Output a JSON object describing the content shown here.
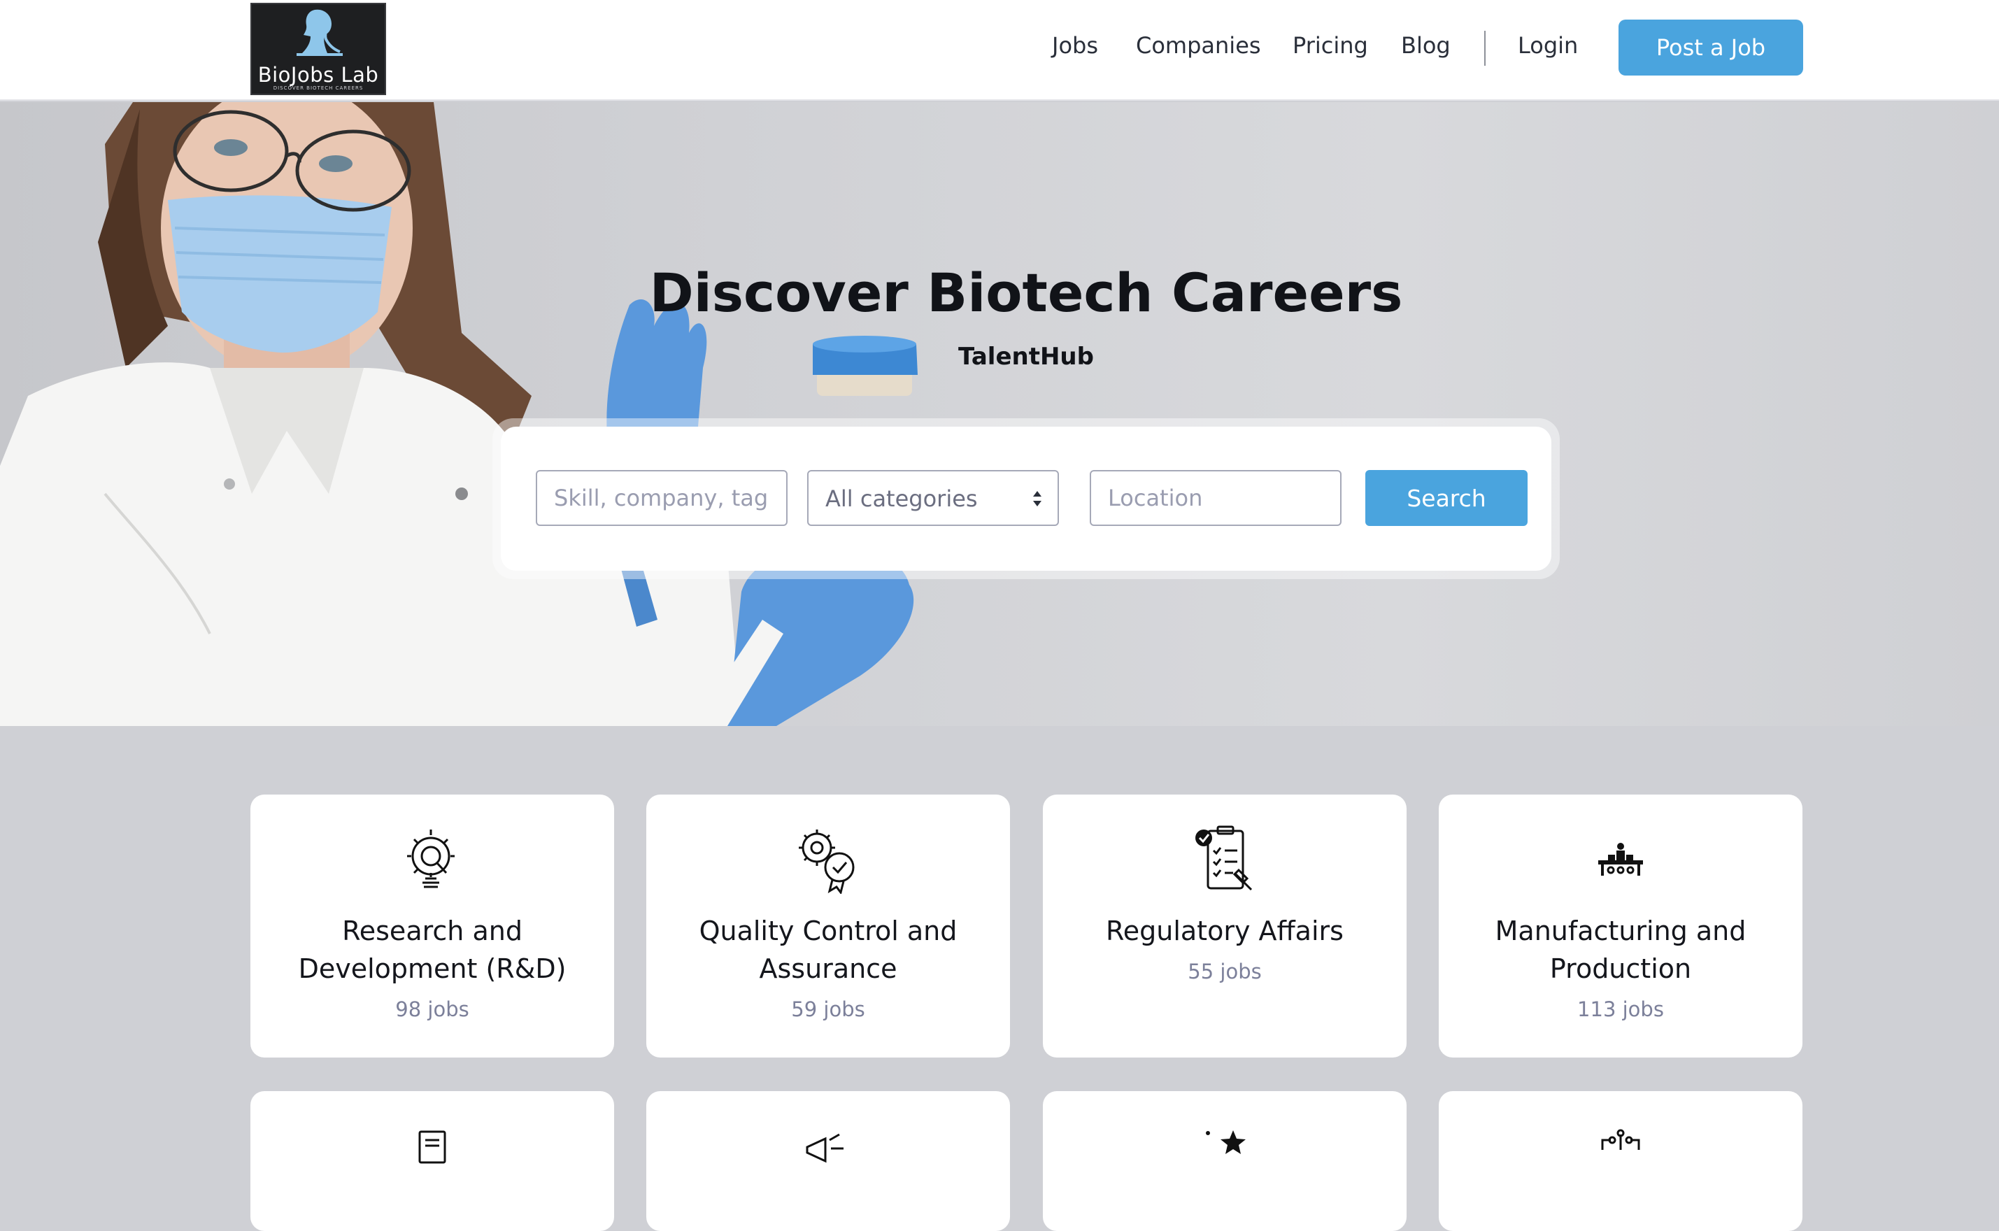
{
  "brand": {
    "name": "BioJobs Lab",
    "tagline": "DISCOVER BIOTECH CAREERS"
  },
  "nav": {
    "jobs": "Jobs",
    "companies": "Companies",
    "pricing": "Pricing",
    "blog": "Blog",
    "login": "Login",
    "post_job": "Post a Job"
  },
  "hero": {
    "title": "Discover Biotech Careers",
    "subtitle": "TalentHub"
  },
  "search": {
    "keyword_placeholder": "Skill, company, tag",
    "category_selected": "All categories",
    "location_placeholder": "Location",
    "button_label": "Search"
  },
  "categories": [
    {
      "title": "Research and Development (R&D)",
      "count": "98 jobs",
      "icon": "research-gear-icon"
    },
    {
      "title": "Quality Control and Assurance",
      "count": "59 jobs",
      "icon": "quality-badge-icon"
    },
    {
      "title": "Regulatory Affairs",
      "count": "55 jobs",
      "icon": "regulatory-clipboard-icon"
    },
    {
      "title": "Manufacturing and Production",
      "count": "113 jobs",
      "icon": "production-line-icon"
    },
    {
      "icon": "document-icon"
    },
    {
      "icon": "megaphone-icon"
    },
    {
      "icon": "star-award-icon"
    },
    {
      "icon": "circuit-icon"
    }
  ],
  "colors": {
    "accent": "#4aa4de",
    "page_background": "#cfd0d5",
    "header_background": "#ffffff",
    "count_text": "#7c809a"
  }
}
